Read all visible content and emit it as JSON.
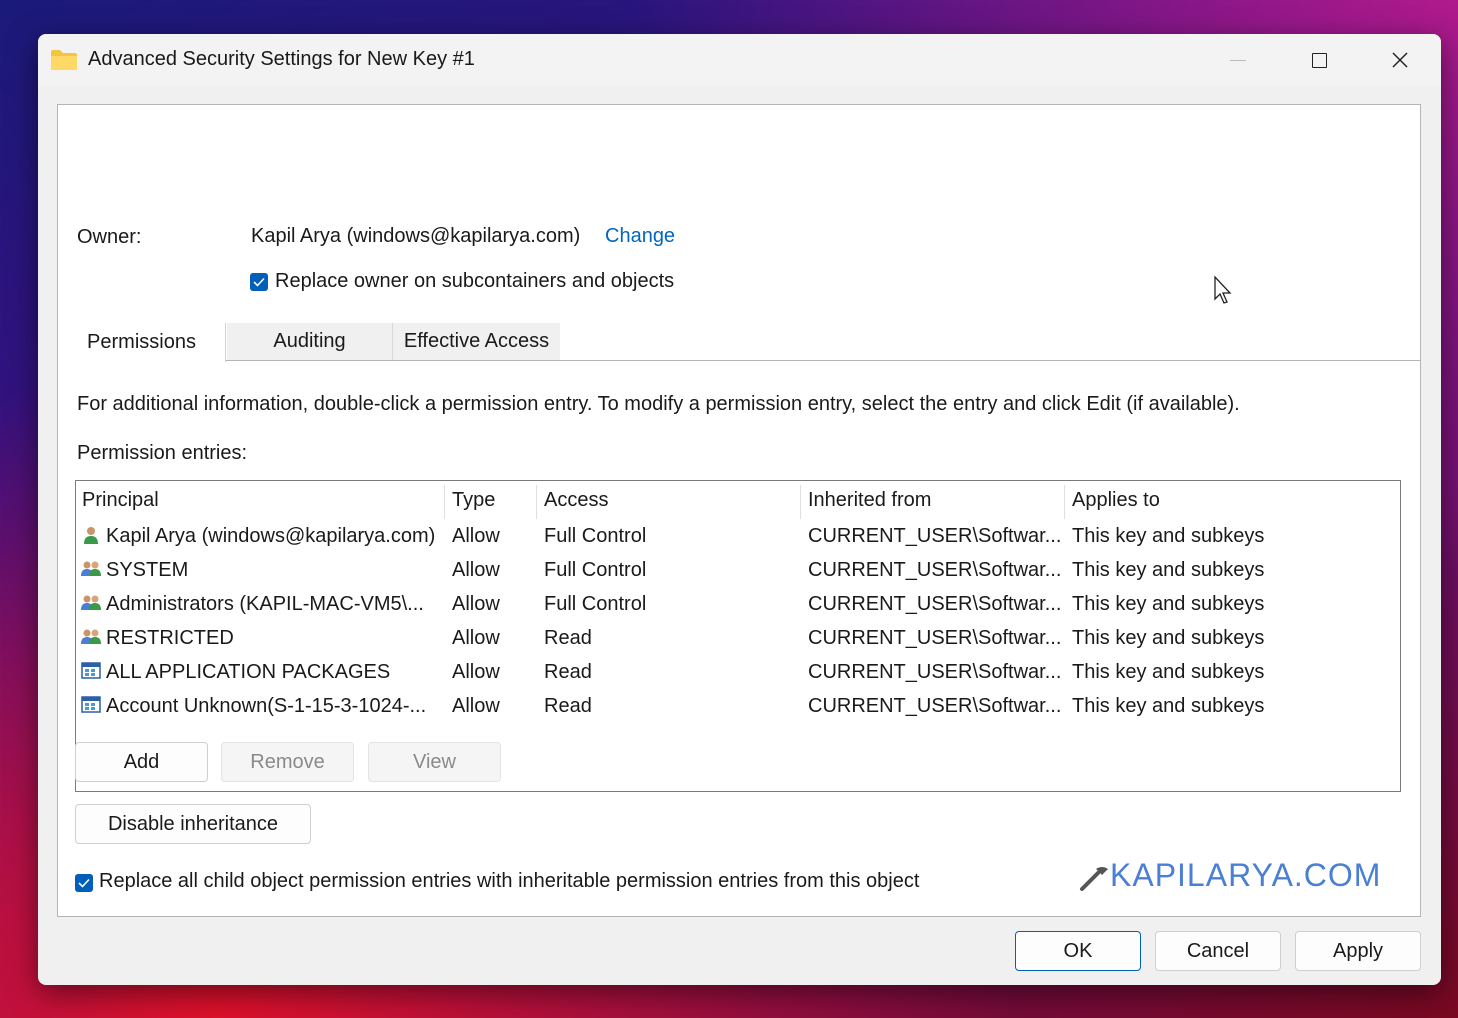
{
  "window": {
    "title": "Advanced Security Settings for New Key #1",
    "icon": "folder-icon",
    "controls": [
      "minimize-icon",
      "maximize-icon",
      "close-icon"
    ]
  },
  "owner": {
    "label": "Owner:",
    "value": "Kapil Arya (windows@kapilarya.com)",
    "change_link": "Change",
    "replace_checkbox_label": "Replace owner on subcontainers and objects",
    "replace_checked": true
  },
  "tabs": [
    {
      "label": "Permissions",
      "active": true
    },
    {
      "label": "Auditing",
      "active": false
    },
    {
      "label": "Effective Access",
      "active": false
    }
  ],
  "info_text": "For additional information, double-click a permission entry. To modify a permission entry, select the entry and click Edit (if available).",
  "entries_label": "Permission entries:",
  "table": {
    "columns": [
      "Principal",
      "Type",
      "Access",
      "Inherited from",
      "Applies to"
    ],
    "rows": [
      {
        "principal": "Kapil Arya (windows@kapilarya.com)",
        "type": "Allow",
        "access": "Full Control",
        "inherited": "CURRENT_USER\\Softwar...",
        "applies": "This key and subkeys",
        "icon": "user-icon"
      },
      {
        "principal": "SYSTEM",
        "type": "Allow",
        "access": "Full Control",
        "inherited": "CURRENT_USER\\Softwar...",
        "applies": "This key and subkeys",
        "icon": "group-icon"
      },
      {
        "principal": "Administrators (KAPIL-MAC-VM5\\...",
        "type": "Allow",
        "access": "Full Control",
        "inherited": "CURRENT_USER\\Softwar...",
        "applies": "This key and subkeys",
        "icon": "group-icon"
      },
      {
        "principal": "RESTRICTED",
        "type": "Allow",
        "access": "Read",
        "inherited": "CURRENT_USER\\Softwar...",
        "applies": "This key and subkeys",
        "icon": "group-icon"
      },
      {
        "principal": "ALL APPLICATION PACKAGES",
        "type": "Allow",
        "access": "Read",
        "inherited": "CURRENT_USER\\Softwar...",
        "applies": "This key and subkeys",
        "icon": "package-icon"
      },
      {
        "principal": "Account Unknown(S-1-15-3-1024-...",
        "type": "Allow",
        "access": "Read",
        "inherited": "CURRENT_USER\\Softwar...",
        "applies": "This key and subkeys",
        "icon": "package-icon"
      }
    ]
  },
  "buttons": {
    "add": "Add",
    "remove": "Remove",
    "view": "View",
    "disable_inheritance": "Disable inheritance",
    "ok": "OK",
    "cancel": "Cancel",
    "apply": "Apply"
  },
  "replace_child": {
    "label": "Replace all child object permission entries with inheritable permission entries from this object",
    "checked": true
  },
  "watermark": "KAPILARYA.COM",
  "colors": {
    "accent": "#005fb8",
    "link": "#0067c0",
    "watermark": "#4a7fd4"
  }
}
